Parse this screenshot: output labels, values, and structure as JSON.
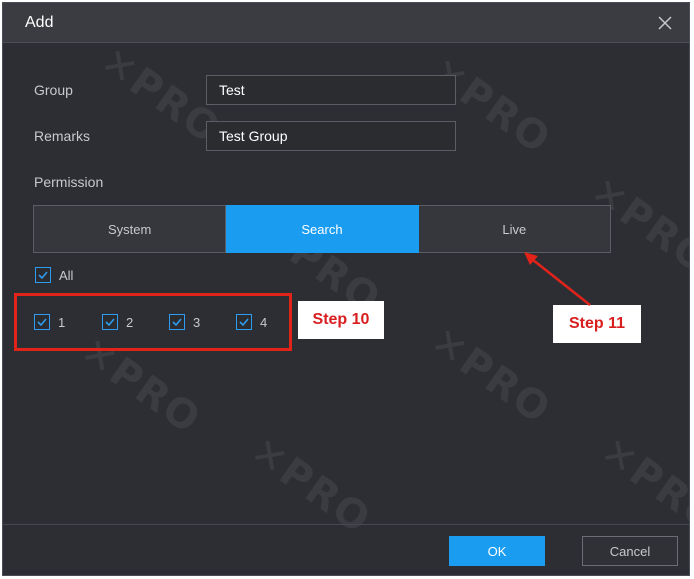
{
  "dialog": {
    "title": "Add",
    "close_icon": "close-icon"
  },
  "form": {
    "group_label": "Group",
    "group_value": "Test",
    "remarks_label": "Remarks",
    "remarks_value": "Test Group",
    "permission_label": "Permission"
  },
  "tabs": [
    {
      "label": "System",
      "active": false
    },
    {
      "label": "Search",
      "active": true
    },
    {
      "label": "Live",
      "active": false
    }
  ],
  "checkboxes": {
    "all": {
      "label": "All",
      "checked": true
    },
    "items": [
      {
        "label": "1",
        "checked": true
      },
      {
        "label": "2",
        "checked": true
      },
      {
        "label": "3",
        "checked": true
      },
      {
        "label": "4",
        "checked": true
      }
    ]
  },
  "annotations": {
    "step10": "Step 10",
    "step11": "Step 11",
    "highlight_color": "#e2231a"
  },
  "footer": {
    "ok_label": "OK",
    "cancel_label": "Cancel"
  },
  "colors": {
    "accent": "#1a9cf0",
    "background": "#2c2e33"
  }
}
